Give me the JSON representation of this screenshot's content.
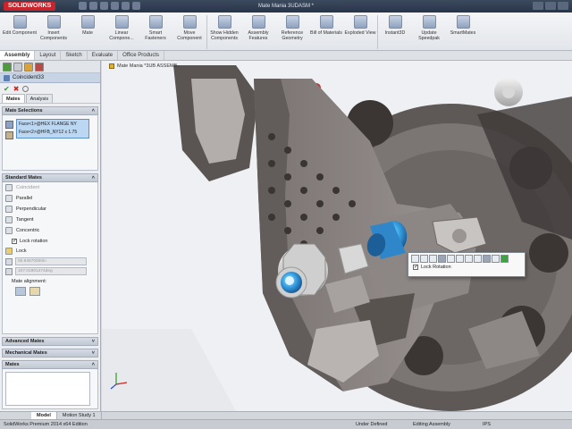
{
  "app": {
    "logo": "SOLIDWORKS",
    "document_title": "Mate Mania 3UDASM *"
  },
  "ribbon": [
    {
      "label": "Edit Component",
      "icon": "edit-component-icon"
    },
    {
      "label": "Insert Components",
      "icon": "insert-components-icon"
    },
    {
      "label": "Mate",
      "icon": "mate-icon"
    },
    {
      "label": "Linear Compone...",
      "icon": "linear-pattern-icon"
    },
    {
      "label": "Smart Fasteners",
      "icon": "smart-fasteners-icon"
    },
    {
      "label": "Move Component",
      "icon": "move-component-icon"
    },
    {
      "label": "Show Hidden Components",
      "icon": "show-hidden-icon"
    },
    {
      "label": "Assembly Features",
      "icon": "assembly-features-icon"
    },
    {
      "label": "Reference Geometry",
      "icon": "reference-geometry-icon"
    },
    {
      "label": "Bill of Materials",
      "icon": "bill-of-materials-icon"
    },
    {
      "label": "Exploded View",
      "icon": "exploded-view-icon"
    },
    {
      "label": "Instant3D",
      "icon": "instant3d-icon"
    },
    {
      "label": "Update Speedpak",
      "icon": "speedpak-icon"
    },
    {
      "label": "SmartMates",
      "icon": "smartmates-icon"
    }
  ],
  "command_tabs": [
    "Assembly",
    "Layout",
    "Sketch",
    "Evaluate",
    "Office Products"
  ],
  "property_manager": {
    "title": "Coincident33",
    "tabs": [
      "Mates",
      "Analysis"
    ],
    "mate_selections": {
      "header": "Mate Selections",
      "items": [
        "Face<1>@HEX FLANGE NY",
        "Face<2>@HFB_NY12 x 1.75"
      ]
    },
    "standard_mates": {
      "header": "Standard Mates",
      "mates": [
        {
          "label": "Coincident",
          "icon": "coincident-icon",
          "dim": true
        },
        {
          "label": "Parallel",
          "icon": "parallel-icon",
          "dim": false
        },
        {
          "label": "Perpendicular",
          "icon": "perpendicular-icon",
          "dim": false
        },
        {
          "label": "Tangent",
          "icon": "tangent-icon",
          "dim": false
        },
        {
          "label": "Concentric",
          "icon": "concentric-icon",
          "dim": false
        }
      ],
      "lock_rotation": "Lock rotation",
      "lock": "Lock",
      "distance": "00.94570000in",
      "angle": "107.01901474deg",
      "mate_alignment": "Mate alignment:"
    },
    "advanced_mates": "Advanced Mates",
    "mechanical_mates": "Mechanical Mates",
    "mates_group": "Mates"
  },
  "viewport": {
    "tree_label": "Mate Mania *3UB ASSEMB..",
    "popup_lock_rotation": "Lock Rotation"
  },
  "bottom_tabs": [
    "Model",
    "Motion Study 1"
  ],
  "status": {
    "edition": "SolidWorks Premium 2014 x64 Edition",
    "definition": "Under Defined",
    "mode": "Editing Assembly",
    "units": "IPS"
  },
  "colors": {
    "accent": "#c8242b",
    "selection": "#bcd7f2",
    "blue_part": "#3a8fd4"
  }
}
